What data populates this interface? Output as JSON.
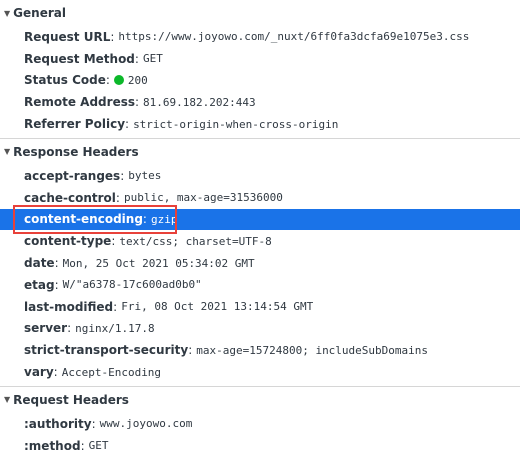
{
  "general": {
    "title": "General",
    "rows": [
      {
        "name": "Request URL",
        "value": "https://www.joyowo.com/_nuxt/6ff0fa3dcfa69e1075e3.css"
      },
      {
        "name": "Request Method",
        "value": "GET"
      },
      {
        "name": "Status Code",
        "value": "200"
      },
      {
        "name": "Remote Address",
        "value": "81.69.182.202:443"
      },
      {
        "name": "Referrer Policy",
        "value": "strict-origin-when-cross-origin"
      }
    ]
  },
  "response_headers": {
    "title": "Response Headers",
    "rows": [
      {
        "name": "accept-ranges",
        "value": "bytes"
      },
      {
        "name": "cache-control",
        "value": "public, max-age=31536000"
      },
      {
        "name": "content-encoding",
        "value": "gzip"
      },
      {
        "name": "content-type",
        "value": "text/css; charset=UTF-8"
      },
      {
        "name": "date",
        "value": "Mon, 25 Oct 2021 05:34:02 GMT"
      },
      {
        "name": "etag",
        "value": "W/\"a6378-17c600ad0b0\""
      },
      {
        "name": "last-modified",
        "value": "Fri, 08 Oct 2021 13:14:54 GMT"
      },
      {
        "name": "server",
        "value": "nginx/1.17.8"
      },
      {
        "name": "strict-transport-security",
        "value": "max-age=15724800; includeSubDomains"
      },
      {
        "name": "vary",
        "value": "Accept-Encoding"
      }
    ]
  },
  "request_headers": {
    "title": "Request Headers",
    "rows": [
      {
        "name": ":authority",
        "value": "www.joyowo.com"
      },
      {
        "name": ":method",
        "value": "GET"
      }
    ]
  },
  "icons": {
    "expanded_triangle": "triangle-down-icon",
    "status_indicator": "status-dot-icon"
  },
  "colors": {
    "selected_row": "#1a73e8",
    "status_ok": "#0cb82a",
    "highlight_box": "#e8413a"
  }
}
